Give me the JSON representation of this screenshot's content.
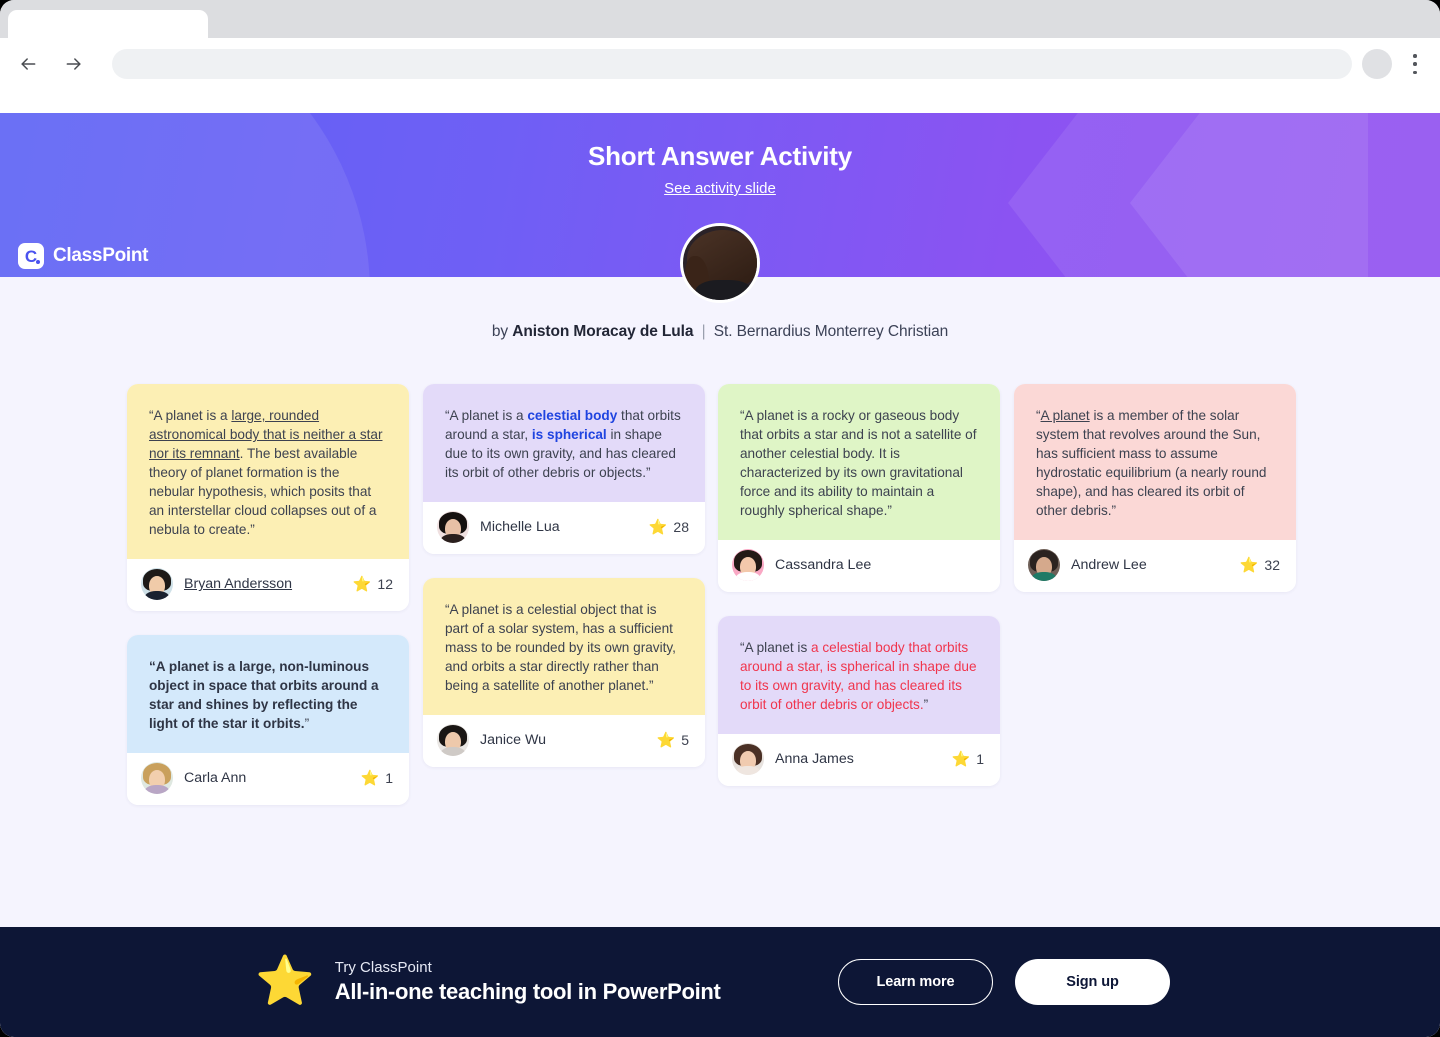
{
  "browser": {
    "back_icon": "arrow-left-icon",
    "forward_icon": "arrow-right-icon",
    "reload_icon": "reload-icon",
    "url_value": "",
    "url_placeholder": "",
    "menu_icon": "kebab-menu-icon"
  },
  "header": {
    "logo_mark": "C",
    "logo_text": "ClassPoint",
    "title": "Short Answer Activity",
    "link": "See activity slide",
    "avatar": "presenter-avatar"
  },
  "byline": {
    "prefix": "by",
    "author": "Aniston Moracay de Lula",
    "separator": "|",
    "school": "St. Bernardius Monterrey Christian"
  },
  "cards": [
    {
      "id": "bryan-andersson",
      "bg": "#fcefb4",
      "name": "Bryan Andersson",
      "name_underlined": true,
      "stars": "12",
      "star_icon": "star-icon",
      "segments": [
        {
          "text": "“A planet is a ",
          "style": "plain"
        },
        {
          "text": "large, rounded astronomical body that is neither a star nor its remnant",
          "style": "underline"
        },
        {
          "text": ". The best available theory of planet formation is the nebular hypothesis, which posits that an interstellar cloud collapses out of a nebula to create.”",
          "style": "plain"
        }
      ]
    },
    {
      "id": "michelle-lua",
      "bg": "#e3daf9",
      "name": "Michelle Lua",
      "name_underlined": false,
      "stars": "28",
      "star_icon": "star-icon",
      "segments": [
        {
          "text": "“A planet is a ",
          "style": "plain"
        },
        {
          "text": "celestial body",
          "style": "blue-bold"
        },
        {
          "text": " that orbits around a star, ",
          "style": "plain"
        },
        {
          "text": "is spherical",
          "style": "blue-bold"
        },
        {
          "text": " in shape due to its own gravity, and has cleared its orbit of other debris or objects.”",
          "style": "plain"
        }
      ]
    },
    {
      "id": "cassandra-lee",
      "bg": "#dff5c6",
      "name": "Cassandra Lee",
      "name_underlined": false,
      "stars": "",
      "star_icon": "",
      "segments": [
        {
          "text": "“A planet is a rocky or gaseous body that orbits a star and is not a satellite of another celestial body. It is characterized by its own gravitational force and its ability to maintain a roughly spherical shape.”",
          "style": "plain"
        }
      ]
    },
    {
      "id": "andrew-lee",
      "bg": "#fbd8d6",
      "name": "Andrew Lee",
      "name_underlined": false,
      "stars": "32",
      "star_icon": "star-icon",
      "segments": [
        {
          "text": "“",
          "style": "plain"
        },
        {
          "text": "A planet",
          "style": "underline"
        },
        {
          "text": " is a member of the solar system that revolves around the Sun, has sufficient mass to assume hydrostatic equilibrium (a nearly round shape), and has cleared its orbit of other debris.”",
          "style": "plain"
        }
      ]
    },
    {
      "id": "carla-ann",
      "bg": "#d4e9fb",
      "name": "Carla Ann",
      "name_underlined": false,
      "stars": "1",
      "star_icon": "star-icon",
      "segments": [
        {
          "text": "“A planet is a large, non-luminous object in space that orbits around a star and shines by reflecting the light of the star it orbits.",
          "style": "bold"
        },
        {
          "text": "”",
          "style": "plain"
        }
      ]
    },
    {
      "id": "janice-wu",
      "bg": "#fcefb4",
      "name": "Janice Wu",
      "name_underlined": false,
      "stars": "5",
      "star_icon": "star-icon",
      "segments": [
        {
          "text": "“A planet is a celestial object that is part of a solar system, has a sufficient mass to be rounded by its own gravity, and orbits a star directly rather than being a satellite of another planet.”",
          "style": "plain"
        }
      ]
    },
    {
      "id": "anna-james",
      "bg": "#e3daf9",
      "name": "Anna James",
      "name_underlined": false,
      "stars": "1",
      "star_icon": "star-icon",
      "segments": [
        {
          "text": "“A planet is ",
          "style": "plain"
        },
        {
          "text": "a celestial body that orbits around a star, is spherical in shape due to its own gravity, and has cleared its orbit of other debris or objects.",
          "style": "red"
        },
        {
          "text": "”",
          "style": "plain"
        }
      ]
    }
  ],
  "banner": {
    "star_icon": "star-icon",
    "eyebrow": "Try ClassPoint",
    "headline": "All-in-one teaching tool in PowerPoint",
    "learn_more": "Learn more",
    "sign_up": "Sign up"
  },
  "colors": {
    "hero_start": "#5d63f5",
    "hero_end": "#9151f0",
    "page_bg": "#f5f4fe",
    "banner_bg": "#0d1636",
    "highlight_blue": "#1f44e0",
    "highlight_red": "#f0354d"
  }
}
